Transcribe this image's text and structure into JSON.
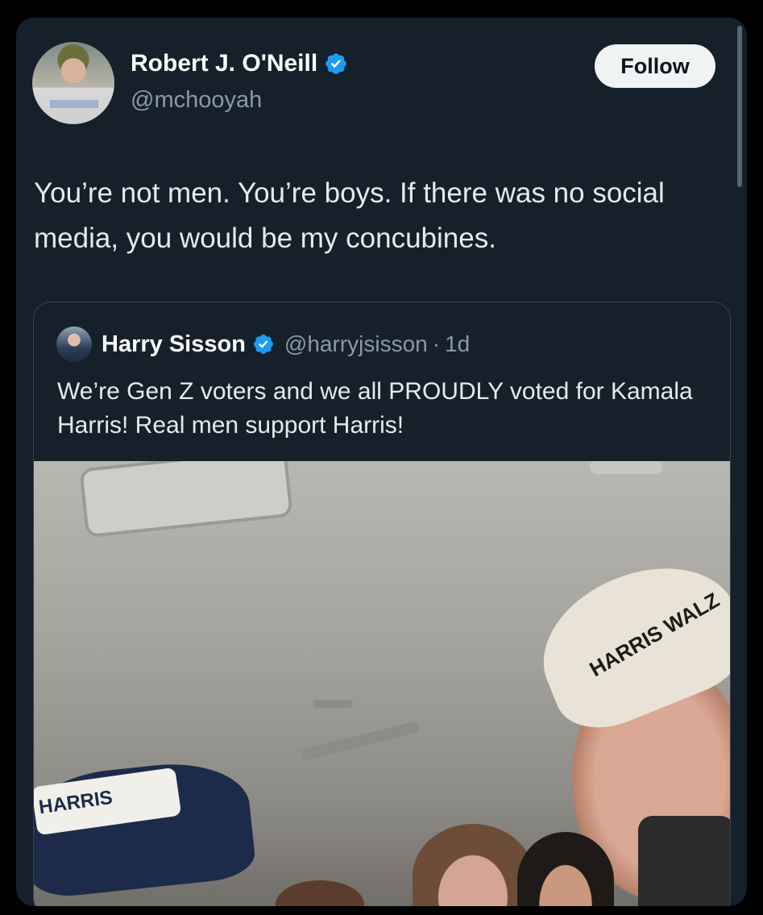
{
  "author": {
    "display_name": "Robert J. O'Neill",
    "handle": "@mchooyah",
    "verified_icon": "verified-badge-icon",
    "avatar": "profile-photo"
  },
  "follow_button": {
    "label": "Follow"
  },
  "tweet": {
    "text": "You’re not men. You’re boys. If there was no social media, you would be my concubines."
  },
  "quoted_tweet": {
    "display_name": "Harry Sisson",
    "handle": "@harryjsisson",
    "separator": "·",
    "time": "1d",
    "text": "We’re Gen Z voters and we all PROUDLY voted for Kamala Harris! Real men support Harris!",
    "media": {
      "type": "photo",
      "cap_right_text": "HARRIS WALZ",
      "cap_left_text": "HARRIS"
    }
  },
  "colors": {
    "background": "#15202b",
    "text": "#e7e9ea",
    "secondary_text": "#8b98a5",
    "verified_blue": "#1d9bf0",
    "button_bg": "#eff3f4",
    "border": "#38444d"
  }
}
